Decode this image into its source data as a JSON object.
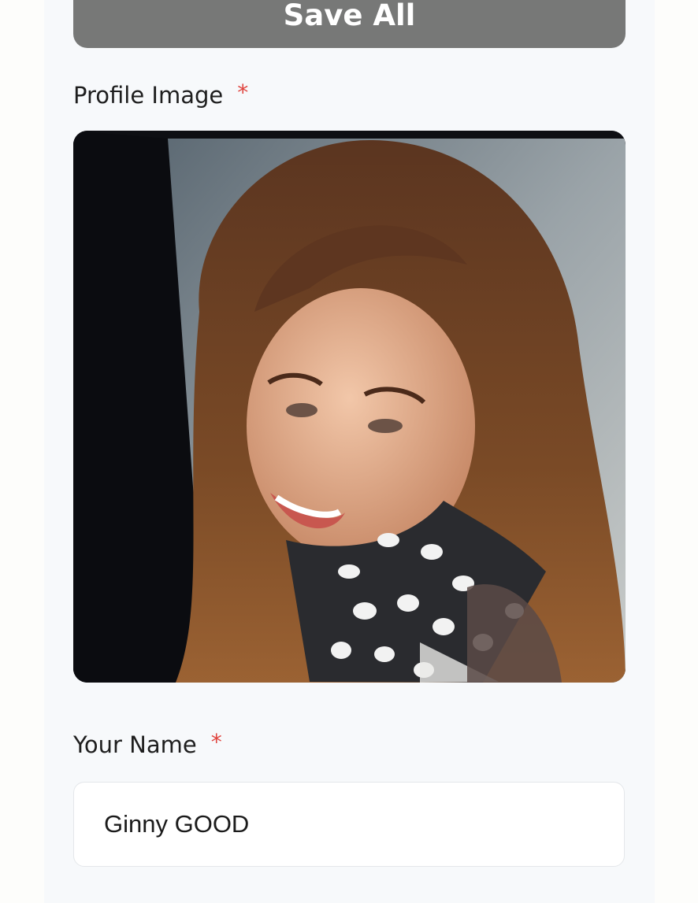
{
  "toolbar": {
    "save_all_label": "Save All"
  },
  "profile_image": {
    "label": "Profile Image",
    "required_marker": "*"
  },
  "your_name": {
    "label": "Your Name",
    "required_marker": "*",
    "value": "Ginny GOOD"
  },
  "colors": {
    "button_bg": "#777877",
    "required": "#e0443e",
    "panel_bg": "#f7f9fb"
  }
}
